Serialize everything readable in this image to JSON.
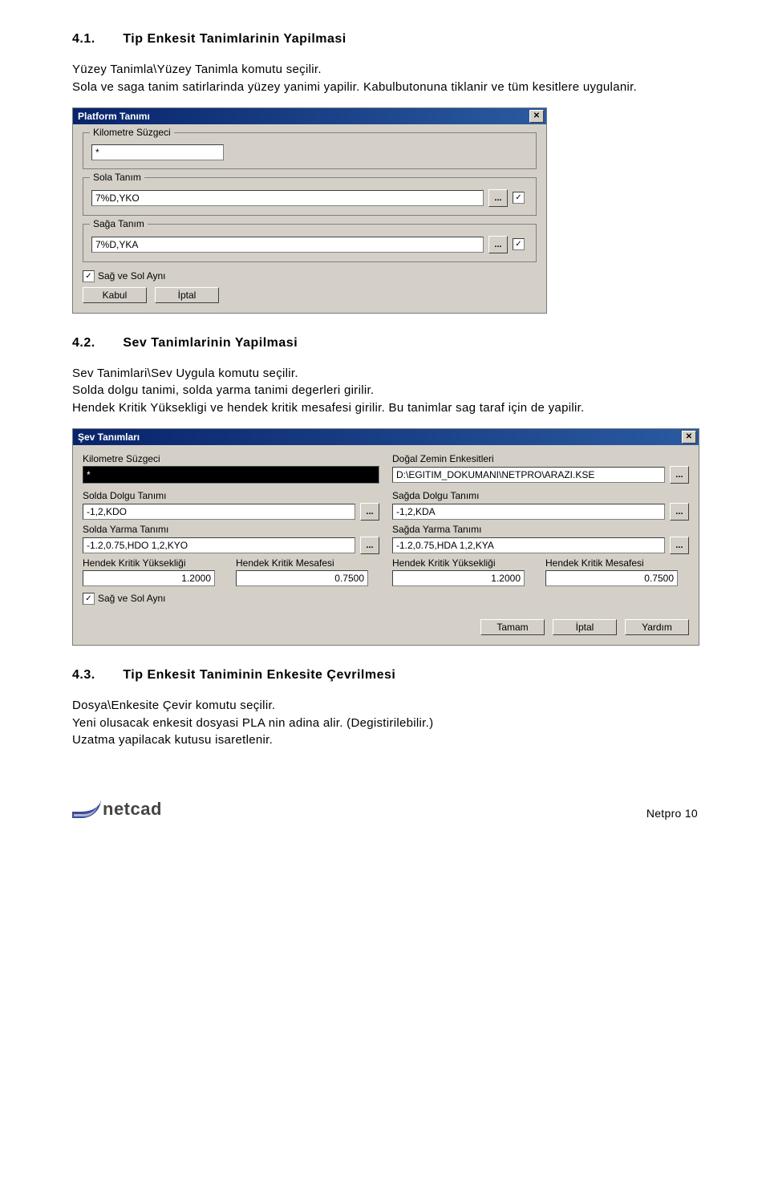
{
  "section1": {
    "num": "4.1.",
    "title": "Tip Enkesit Tanimlarinin Yapilmasi",
    "para": "Yüzey Tanimla\\Yüzey Tanimla komutu seçilir.\nSola ve saga tanim satirlarinda yüzey yanimi yapilir. Kabulbutonuna tiklanir ve tüm kesitlere uygulanir."
  },
  "dialog1": {
    "title": "Platform Tanımı",
    "km_label": "Kilometre Süzgeci",
    "km_value": "*",
    "sola_label": "Sola Tanım",
    "sola_value": "7%D,YKO",
    "saga_label": "Sağa Tanım",
    "saga_value": "7%D,YKA",
    "sag_sol_check": "✓",
    "sag_sol_label": "Sağ ve Sol Aynı",
    "btn_kabul": "Kabul",
    "btn_iptal": "İptal"
  },
  "section2": {
    "num": "4.2.",
    "title": "Sev Tanimlarinin Yapilmasi",
    "para": "Sev Tanimlari\\Sev Uygula komutu seçilir.\nSolda dolgu tanimi, solda yarma tanimi degerleri girilir.\nHendek Kritik Yüksekligi ve hendek kritik mesafesi girilir. Bu tanimlar sag taraf için de yapilir."
  },
  "dialog2": {
    "title": "Şev Tanımları",
    "km_label": "Kilometre Süzgeci",
    "km_value": "*",
    "dogal_label": "Doğal Zemin Enkesitleri",
    "dogal_value": "D:\\EGITIM_DOKUMANI\\NETPRO\\ARAZI.KSE",
    "sol_dolgu_label": "Solda Dolgu Tanımı",
    "sol_dolgu_value": "-1,2,KDO",
    "sag_dolgu_label": "Sağda Dolgu Tanımı",
    "sag_dolgu_value": "-1,2,KDA",
    "sol_yarma_label": "Solda Yarma Tanımı",
    "sol_yarma_value": "-1.2,0.75,HDO 1,2,KYO",
    "sag_yarma_label": "Sağda Yarma Tanımı",
    "sag_yarma_value": "-1.2,0.75,HDA 1,2,KYA",
    "hkh_label": "Hendek Kritik Yüksekliği",
    "hkm_label": "Hendek Kritik Mesafesi",
    "sol_hkh": "1.2000",
    "sol_hkm": "0.7500",
    "sag_hkh": "1.2000",
    "sag_hkm": "0.7500",
    "sag_sol_check": "✓",
    "sag_sol_label": "Sağ ve Sol Aynı",
    "btn_tamam": "Tamam",
    "btn_iptal": "İptal",
    "btn_yardim": "Yardım"
  },
  "section3": {
    "num": "4.3.",
    "title": "Tip Enkesit Taniminin Enkesite Çevrilmesi",
    "para": "Dosya\\Enkesite Çevir komutu seçilir.\nYeni olusacak enkesit dosyasi PLA nin adina alir. (Degistirilebilir.)\nUzatma yapilacak kutusu isaretlenir."
  },
  "footer": {
    "logo_text": "netcad",
    "page": "Netpro   10"
  }
}
